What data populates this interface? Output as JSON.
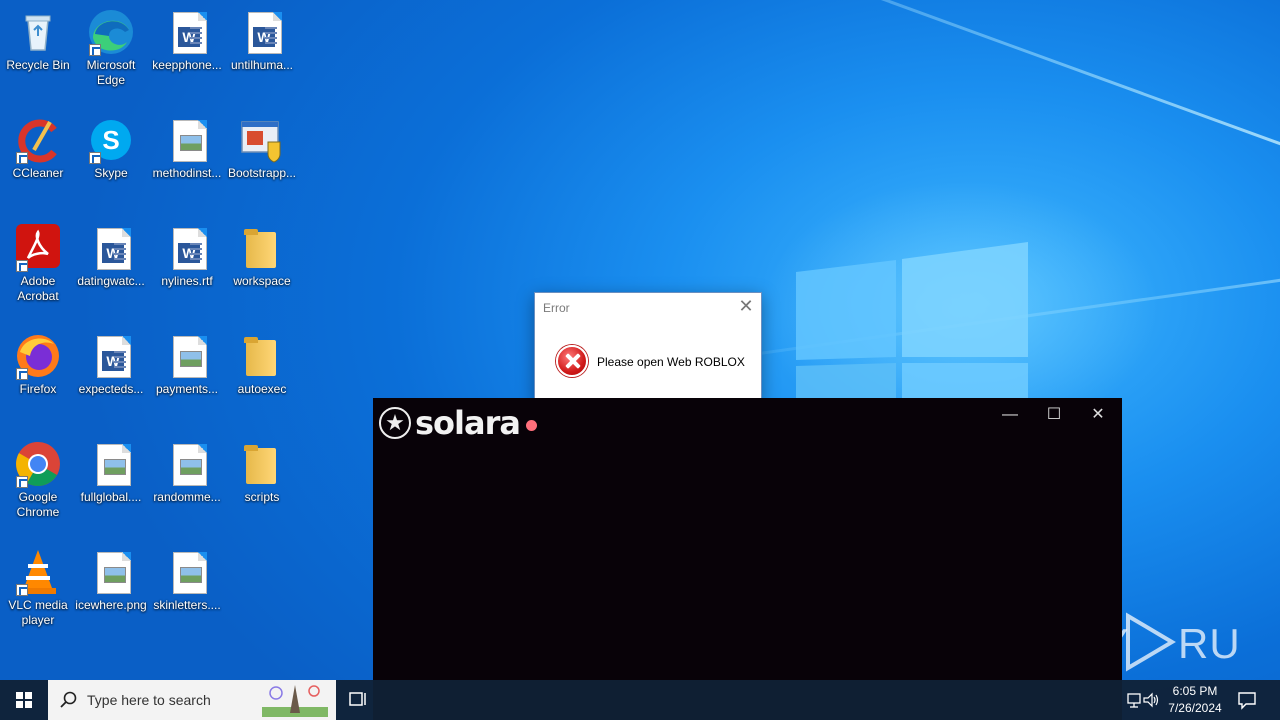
{
  "desktop_icons": [
    {
      "label": "Recycle Bin",
      "icon": "recycle-bin-icon"
    },
    {
      "label": "Microsoft Edge",
      "icon": "edge-icon"
    },
    {
      "label": "keepphone...",
      "icon": "word-doc-icon"
    },
    {
      "label": "untilhuma...",
      "icon": "word-doc-icon"
    },
    {
      "label": "CCleaner",
      "icon": "ccleaner-icon"
    },
    {
      "label": "Skype",
      "icon": "skype-icon"
    },
    {
      "label": "methodinst...",
      "icon": "image-file-icon"
    },
    {
      "label": "Bootstrapp...",
      "icon": "installer-icon"
    },
    {
      "label": "Adobe Acrobat",
      "icon": "acrobat-icon"
    },
    {
      "label": "datingwatc...",
      "icon": "word-doc-icon"
    },
    {
      "label": "nylines.rtf",
      "icon": "word-doc-icon"
    },
    {
      "label": "workspace",
      "icon": "folder-icon"
    },
    {
      "label": "Firefox",
      "icon": "firefox-icon"
    },
    {
      "label": "expecteds...",
      "icon": "word-doc-icon"
    },
    {
      "label": "payments...",
      "icon": "image-file-icon"
    },
    {
      "label": "autoexec",
      "icon": "folder-icon"
    },
    {
      "label": "Google Chrome",
      "icon": "chrome-icon"
    },
    {
      "label": "fullglobal....",
      "icon": "image-file-icon"
    },
    {
      "label": "randomme...",
      "icon": "image-file-icon"
    },
    {
      "label": "scripts",
      "icon": "folder-icon"
    },
    {
      "label": "VLC media player",
      "icon": "vlc-icon"
    },
    {
      "label": "icewhere.png",
      "icon": "image-file-icon"
    },
    {
      "label": "skinletters....",
      "icon": "image-file-icon"
    }
  ],
  "error_dialog": {
    "title": "Error",
    "message": "Please open Web ROBLOX",
    "close_glyph": "✕"
  },
  "solara": {
    "name": "solara",
    "status_color": "#ff6f7b",
    "minimize_glyph": "—",
    "maximize_glyph": "☐",
    "close_glyph": "✕"
  },
  "taskbar": {
    "search_placeholder": "Type here to search",
    "time": "6:05 PM",
    "date": "7/26/2024"
  },
  "watermark": {
    "text": "ANY RUN"
  }
}
